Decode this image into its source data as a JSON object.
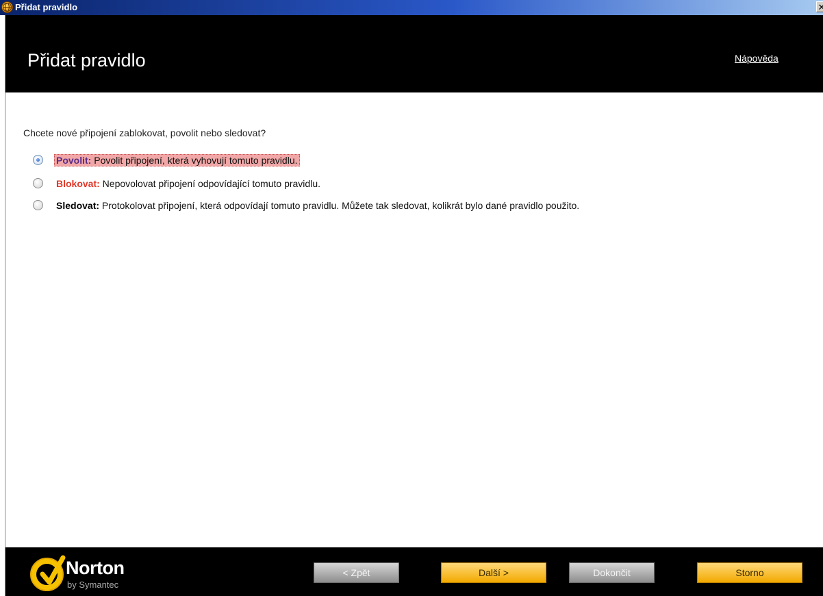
{
  "window": {
    "title": "Přidat pravidlo",
    "close_glyph": "✕"
  },
  "header": {
    "heading": "Přidat pravidlo",
    "help_link": "Nápověda"
  },
  "content": {
    "question": "Chcete nové připojení zablokovat, povolit nebo sledovat?",
    "selected_option": "allow",
    "options": [
      {
        "id": "allow",
        "label": "Povolit:",
        "text": " Povolit připojení, která vyhovují tomuto pravidlu.",
        "label_color": "#5a2d8a",
        "checked": true
      },
      {
        "id": "block",
        "label": "Blokovat:",
        "text": " Nepovolovat připojení odpovídající tomuto pravidlu.",
        "label_color": "#e0382a",
        "checked": false
      },
      {
        "id": "track",
        "label": "Sledovat:",
        "text": " Protokolovat připojení, která odpovídají tomuto pravidlu. Můžete tak sledovat, kolikrát bylo dané pravidlo použito.",
        "label_color": "#000000",
        "checked": false
      }
    ]
  },
  "footer": {
    "logo": {
      "brand": "Norton",
      "byline": "by Symantec",
      "icon": "checkmark-circle-icon"
    },
    "buttons": {
      "back": "< Zpět",
      "next": "Další >",
      "finish": "Dokončit",
      "cancel": "Storno"
    }
  },
  "colors": {
    "header_bg": "#000000",
    "footer_bg": "#000000",
    "accent_gold": "#f2a900",
    "highlight_bg": "#f1a7a7"
  }
}
